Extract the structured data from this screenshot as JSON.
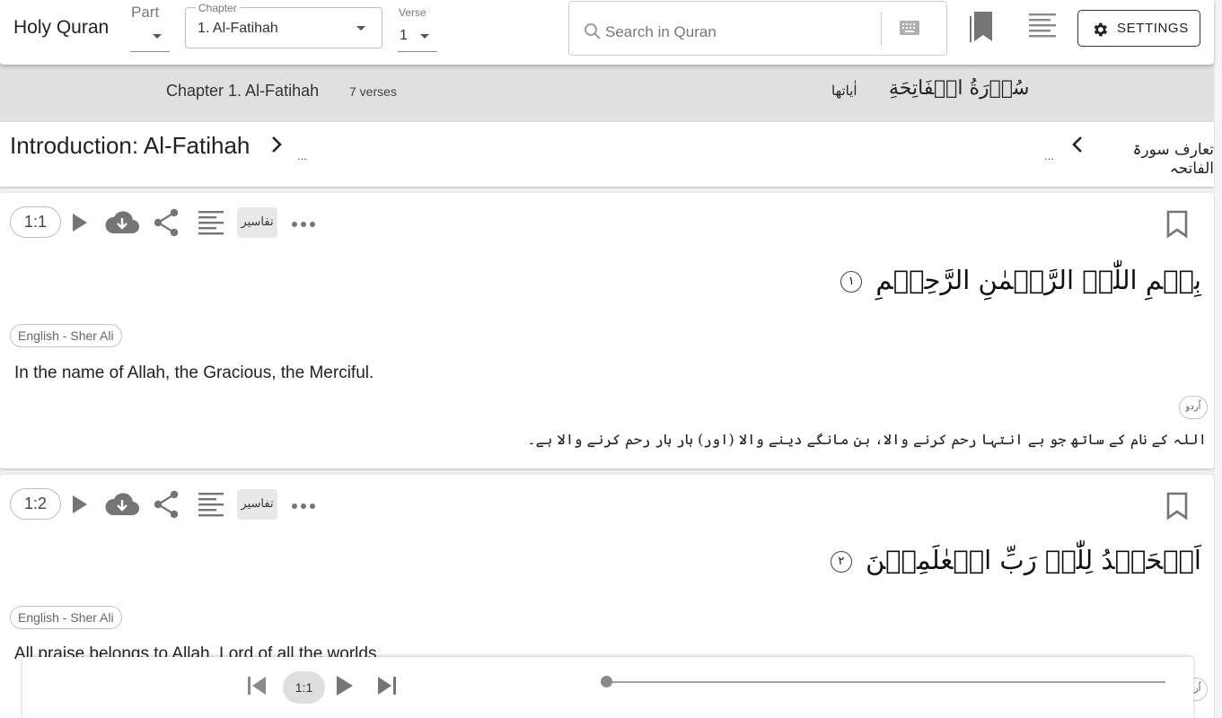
{
  "app": {
    "title": "Holy Quran"
  },
  "nav": {
    "part_label": "Part",
    "chapter_label": "Chapter",
    "chapter_value": "1. Al-Fatihah",
    "verse_label": "Verse",
    "verse_value": "1"
  },
  "search": {
    "placeholder": "Search in Quran",
    "value": ""
  },
  "toolbar": {
    "settings_label": "SETTINGS"
  },
  "icons": [
    "search-icon",
    "keyboard-icon",
    "bookmarks-icon",
    "table-of-contents-icon",
    "gear-icon",
    "play-icon",
    "download-icon",
    "share-icon",
    "notes-icon",
    "more-icon",
    "bookmark-icon",
    "chevron-right-icon",
    "chevron-left-icon",
    "skip-previous-icon",
    "skip-next-icon"
  ],
  "chapter_header": {
    "title": "Chapter 1. Al-Fatihah",
    "verse_count": "7 verses",
    "surah_name_arabic": "سُوۡرَةُ الۡفَاتِحَةِ",
    "ayat_label_arabic": "اٰیاتھا"
  },
  "introduction": {
    "title": "Introduction: Al-Fatihah",
    "more_left": "...",
    "more_right": "...",
    "urdu_title": "تعارف سورۃ الفاتحہ"
  },
  "verses": [
    {
      "number": "1:1",
      "tafasir_label": "تفاسیر",
      "arabic": "بِسۡمِ اللّٰہِ الرَّحۡمٰنِ الرَّحِیۡمِ",
      "ayah_marker": "١",
      "translation_name": "English - Sher Ali",
      "translation": "In the name of Allah, the Gracious, the Merciful.",
      "urdu_label": "اُردو",
      "urdu": "اللہ کے نام کے ساتھ جو بے انتہا رحم کرنے والا، بن مانگے دینے والا (اور) بار بار رحم کرنے والا ہے۔"
    },
    {
      "number": "1:2",
      "tafasir_label": "تفاسیر",
      "arabic": "اَلۡحَمۡدُ لِلّٰہِ رَبِّ الۡعٰلَمِیۡنَ",
      "ayah_marker": "٢",
      "translation_name": "English - Sher Ali",
      "translation": "All praise belongs to Allah, Lord of all the worlds,",
      "urdu_label": "اُردو"
    }
  ],
  "player": {
    "current_verse": "1:1",
    "progress": 0.0
  },
  "colors": {
    "band": "#e0e0e0",
    "chip_border": "#c4c4c4",
    "icon_gray": "#757575"
  }
}
